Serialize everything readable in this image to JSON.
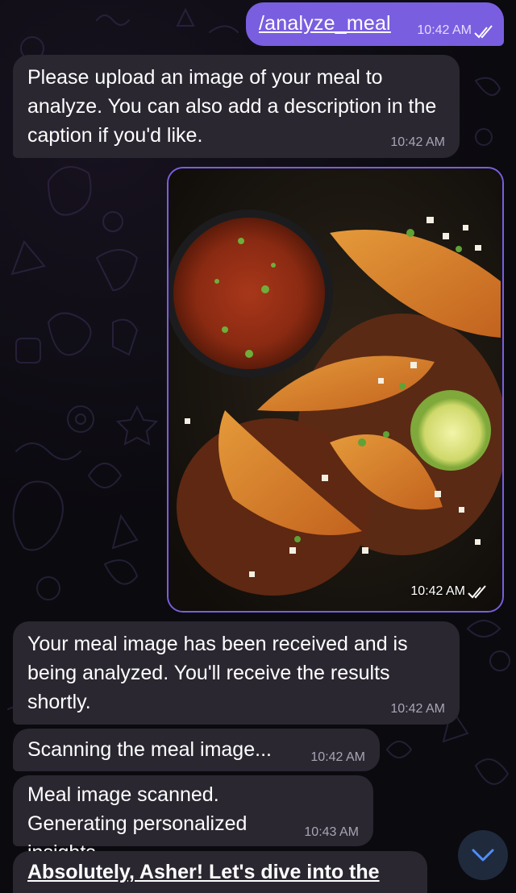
{
  "chat": {
    "command": {
      "text": "/analyze_meal",
      "time": "10:42 AM"
    },
    "messages": [
      {
        "text": "Please upload an image of your meal to analyze. You can also add a description in the caption if you'd like.",
        "time": "10:42 AM"
      },
      {
        "text": "Your meal image has been received and is being analyzed. You'll receive the results shortly.",
        "time": "10:42 AM"
      },
      {
        "text": "Scanning the meal image...",
        "time": "10:42 AM"
      },
      {
        "text": "Meal image scanned. Generating personalized insights...",
        "time": "10:43 AM"
      },
      {
        "text": "Absolutely, Asher! Let's dive into the"
      }
    ],
    "photo": {
      "time": "10:42 AM",
      "icon": "meal-photo"
    }
  },
  "colors": {
    "outgoing_bubble": "#7a5ee0",
    "incoming_bubble": "#2a2731",
    "background": "#0b0a0f",
    "accent": "#4f8ef7"
  },
  "icons": {
    "read_status": "double-check-icon",
    "scroll_down": "chevron-down-icon"
  }
}
